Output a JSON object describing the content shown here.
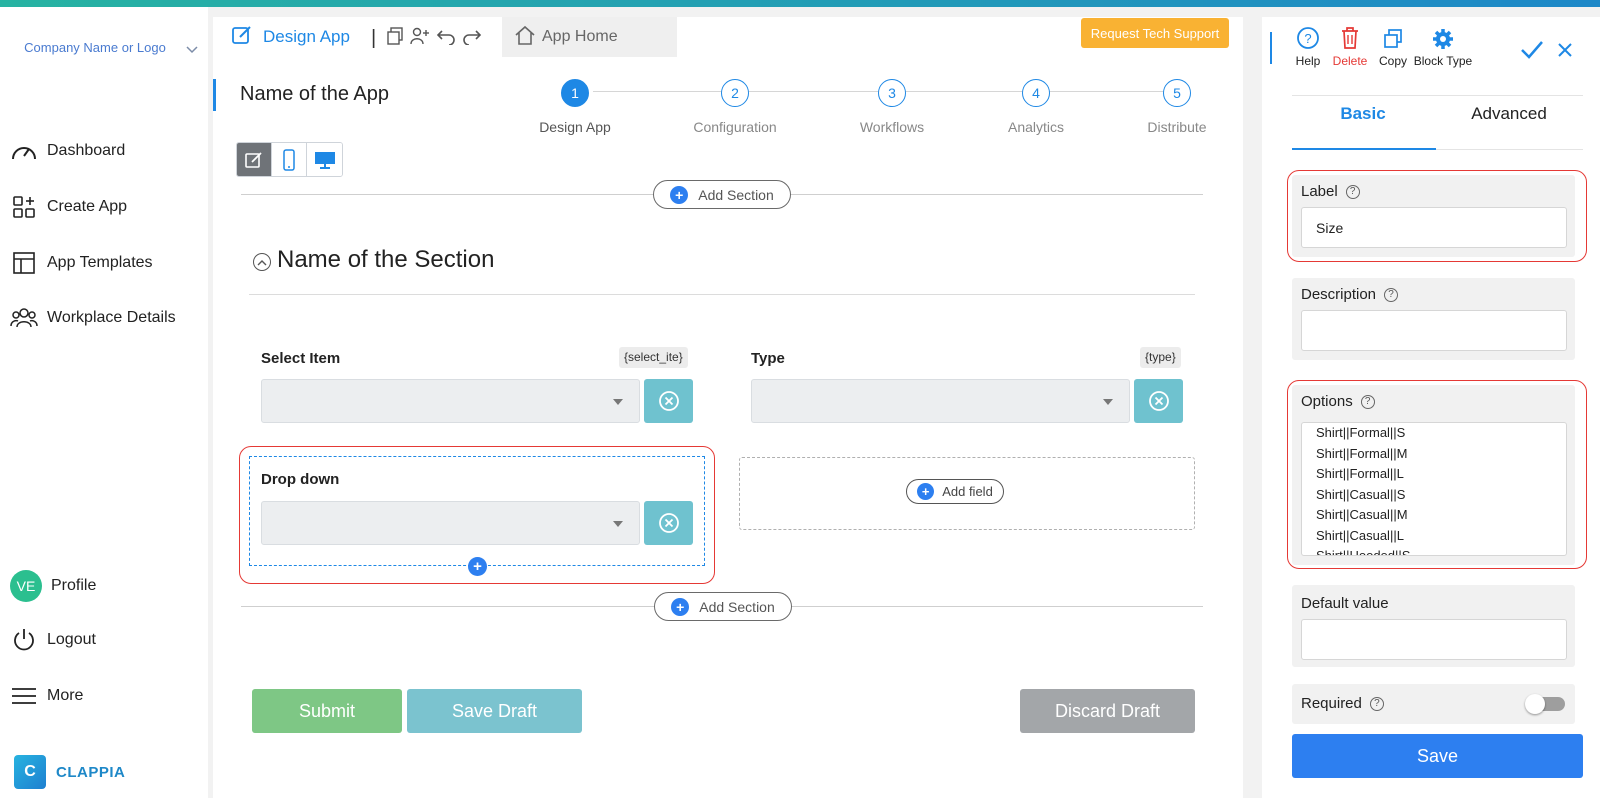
{
  "sidebar": {
    "company": "Company Name or Logo",
    "items": [
      {
        "label": "Dashboard"
      },
      {
        "label": "Create App"
      },
      {
        "label": "App Templates"
      },
      {
        "label": "Workplace Details"
      }
    ],
    "profile": {
      "initials": "VE",
      "label": "Profile"
    },
    "logout": "Logout",
    "more": "More",
    "brand": "CLAPPIA"
  },
  "header": {
    "design_tab": "Design App",
    "home_tab": "App Home",
    "tech_support": "Request Tech Support"
  },
  "app": {
    "name": "Name of the App",
    "steps": [
      {
        "num": "1",
        "label": "Design App",
        "active": true
      },
      {
        "num": "2",
        "label": "Configuration"
      },
      {
        "num": "3",
        "label": "Workflows"
      },
      {
        "num": "4",
        "label": "Analytics"
      },
      {
        "num": "5",
        "label": "Distribute"
      }
    ]
  },
  "canvas": {
    "add_section": "Add Section",
    "section_title": "Name of the Section",
    "fields": [
      {
        "label": "Select Item",
        "var": "{select_ite}"
      },
      {
        "label": "Type",
        "var": "{type}"
      },
      {
        "label": "Drop down"
      }
    ],
    "add_field": "Add field",
    "submit": "Submit",
    "save_draft": "Save Draft",
    "discard_draft": "Discard Draft"
  },
  "panel": {
    "tools": {
      "help": "Help",
      "delete": "Delete",
      "copy": "Copy",
      "block_type": "Block Type"
    },
    "tabs": {
      "basic": "Basic",
      "advanced": "Advanced"
    },
    "label": {
      "title": "Label",
      "value": "Size"
    },
    "description": {
      "title": "Description",
      "value": ""
    },
    "options": {
      "title": "Options",
      "items": [
        "Shirt||Formal||S",
        "Shirt||Formal||M",
        "Shirt||Formal||L",
        "Shirt||Casual||S",
        "Shirt||Casual||M",
        "Shirt||Casual||L",
        "Shirt||Hooded||S"
      ]
    },
    "default_value": {
      "title": "Default value",
      "value": ""
    },
    "required": {
      "title": "Required",
      "on": false
    },
    "save": "Save"
  },
  "colors": {
    "accent": "#1e88e5",
    "highlight": "#e53935",
    "submit": "#7ec785",
    "save_draft": "#7bc3cf",
    "discard": "#a3a6a9",
    "tech_support": "#f9b233",
    "delete": "#e53935"
  }
}
